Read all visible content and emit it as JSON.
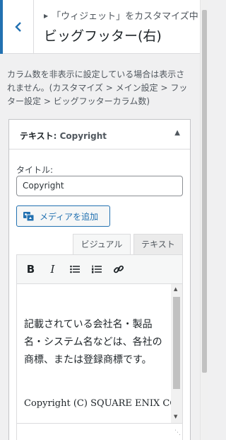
{
  "header": {
    "breadcrumb": "「ウィジェット」をカスタマイズ中",
    "title": "ビッグフッター(右)"
  },
  "description": "カラム数を非表示に設定している場合は表示されません。(カスタマイズ > メイン設定 > フッター設定 > ビッグフッターカラム数)",
  "widget": {
    "type_label": "テキスト",
    "subtitle": ": Copyright",
    "title_label": "タイトル:",
    "title_value": "Copyright",
    "add_media_label": "メディアを追加",
    "tabs": [
      "ビジュアル",
      "テキスト"
    ],
    "editor": {
      "paragraph1": "記載されている会社名・製品名・システム名などは、各社の商標、または登録商標です。",
      "paragraph2": "Copyright (C) SQUARE ENIX CO., LTD. All Rights"
    }
  },
  "colors": {
    "accent": "#2271b1",
    "border": "#c3c4c7"
  },
  "icons": [
    "back-chevron-icon",
    "toggle-arrow-icon",
    "add-media-icon",
    "bold-icon",
    "italic-icon",
    "bullet-list-icon",
    "numbered-list-icon",
    "link-icon",
    "resize-handle-icon"
  ]
}
